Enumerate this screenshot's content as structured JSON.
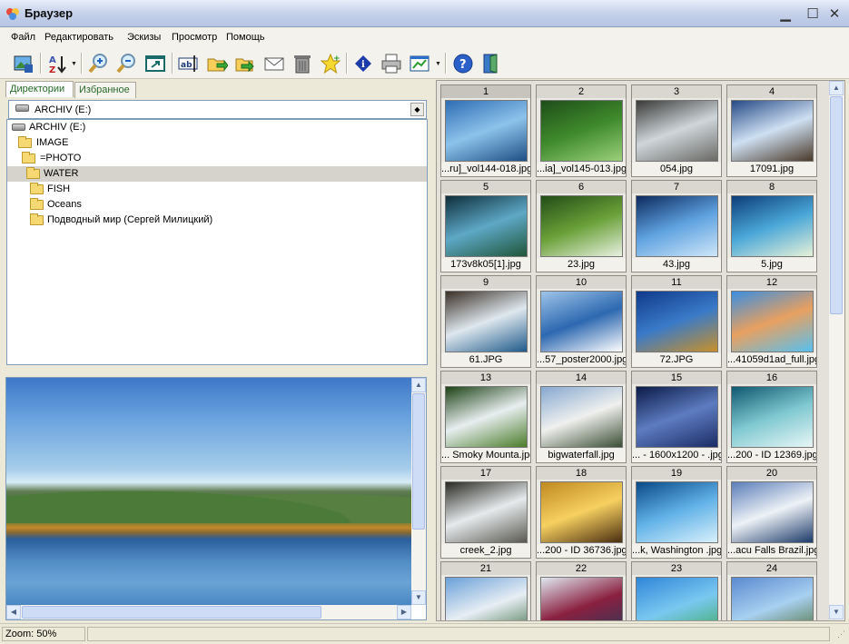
{
  "window": {
    "title": "Браузер"
  },
  "menu": [
    "Файл",
    "Редактировать",
    "Эскизы",
    "Просмотр",
    "Помощь"
  ],
  "toolbar_icons": [
    "image-select-icon",
    "sort-az-icon",
    "zoom-in-icon",
    "zoom-out-icon",
    "fit-window-icon",
    "rename-icon",
    "copy-to-folder-icon",
    "move-to-folder-icon",
    "email-icon",
    "delete-icon",
    "favorite-icon",
    "info-icon",
    "print-icon",
    "chart-icon",
    "help-icon",
    "exit-icon"
  ],
  "tabs": {
    "directories": "Директории",
    "favorites": "Избранное"
  },
  "drive_combo": {
    "value": "ARCHIV (E:)"
  },
  "tree": [
    {
      "label": "ARCHIV (E:)",
      "level": 0,
      "type": "drive"
    },
    {
      "label": "IMAGE",
      "level": 1,
      "type": "folder"
    },
    {
      "label": "=PHOTO",
      "level": 2,
      "type": "folder"
    },
    {
      "label": "WATER",
      "level": 3,
      "type": "folder",
      "selected": true
    },
    {
      "label": "FISH",
      "level": 4,
      "type": "folder"
    },
    {
      "label": "Oceans",
      "level": 4,
      "type": "folder"
    },
    {
      "label": "Подводный мир (Сергей Милицкий)",
      "level": 4,
      "type": "folder"
    }
  ],
  "thumbnails": [
    {
      "num": "1",
      "caption": "...ru]_vol144-018.jpg",
      "colors": [
        "#2f6db4",
        "#8cc3ea",
        "#1f4f86"
      ]
    },
    {
      "num": "2",
      "caption": "...ia]_vol145-013.jpg",
      "colors": [
        "#1f4d1a",
        "#3f8a2c",
        "#9bd07a"
      ]
    },
    {
      "num": "3",
      "caption": "054.jpg",
      "colors": [
        "#3a3a38",
        "#cfd6da",
        "#6a6a66"
      ]
    },
    {
      "num": "4",
      "caption": "17091.jpg",
      "colors": [
        "#264a86",
        "#cfe0f2",
        "#4a3a2a"
      ]
    },
    {
      "num": "5",
      "caption": "173v8k05[1].jpg",
      "colors": [
        "#0e2e3a",
        "#5ea8c6",
        "#20553a"
      ]
    },
    {
      "num": "6",
      "caption": "23.jpg",
      "colors": [
        "#224d18",
        "#6aa038",
        "#e8f0e0"
      ]
    },
    {
      "num": "7",
      "caption": "43.jpg",
      "colors": [
        "#0d2a5e",
        "#5fa2e0",
        "#cfe6f8"
      ]
    },
    {
      "num": "8",
      "caption": "5.jpg",
      "colors": [
        "#0d3d78",
        "#4aa7d8",
        "#e7f1d8"
      ]
    },
    {
      "num": "9",
      "caption": "61.JPG",
      "colors": [
        "#3b3028",
        "#dfe8ee",
        "#1f5a8a"
      ]
    },
    {
      "num": "10",
      "caption": "...57_poster2000.jpg",
      "colors": [
        "#9fc4e8",
        "#2d68b0",
        "#ffffff"
      ]
    },
    {
      "num": "11",
      "caption": "72.JPG",
      "colors": [
        "#0f3a8a",
        "#3a7ac8",
        "#c8902a"
      ]
    },
    {
      "num": "12",
      "caption": "...41059d1ad_full.jpg",
      "colors": [
        "#3a8ee0",
        "#e8a060",
        "#58c0f0"
      ]
    },
    {
      "num": "13",
      "caption": "... Smoky Mounta.jpg",
      "colors": [
        "#1d4216",
        "#e8eef0",
        "#4b7c2a"
      ]
    },
    {
      "num": "14",
      "caption": "bigwaterfall.jpg",
      "colors": [
        "#86a8d0",
        "#f0f0ee",
        "#3a4e34"
      ]
    },
    {
      "num": "15",
      "caption": "... - 1600x1200 - .jpg",
      "colors": [
        "#0c1a48",
        "#5d7cc0",
        "#1c2c66"
      ]
    },
    {
      "num": "16",
      "caption": "...200 - ID 12369.jpg",
      "colors": [
        "#0f5870",
        "#7fc8d0",
        "#e8f6f6"
      ]
    },
    {
      "num": "17",
      "caption": "creek_2.jpg",
      "colors": [
        "#2a2a24",
        "#e6eaec",
        "#5a5a52"
      ]
    },
    {
      "num": "18",
      "caption": "...200 - ID 36736.jpg",
      "colors": [
        "#c08a20",
        "#f6d060",
        "#4a2e10"
      ]
    },
    {
      "num": "19",
      "caption": "...k, Washington .jpg",
      "colors": [
        "#0a4a88",
        "#62b2e8",
        "#d8f0fa"
      ]
    },
    {
      "num": "20",
      "caption": "...acu Falls Brazil.jpg",
      "colors": [
        "#5b7db8",
        "#eef2f6",
        "#1c3a6a"
      ]
    },
    {
      "num": "21",
      "caption": "",
      "colors": [
        "#6aa0d8",
        "#e8eef4",
        "#3a6a40"
      ]
    },
    {
      "num": "22",
      "caption": "",
      "colors": [
        "#dfe8f0",
        "#8a2040",
        "#2a3a5a"
      ]
    },
    {
      "num": "23",
      "caption": "",
      "colors": [
        "#2f86d8",
        "#7ac8f0",
        "#3aa858"
      ]
    },
    {
      "num": "24",
      "caption": "",
      "colors": [
        "#5a8ad0",
        "#a8d0f0",
        "#4a6a30"
      ]
    }
  ],
  "status": {
    "zoom": "Zoom: 50%"
  }
}
